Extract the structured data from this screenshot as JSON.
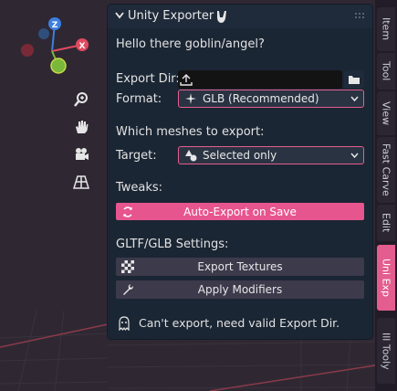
{
  "viewport": {
    "gizmo": {
      "x_label": "X",
      "z_label": "Z"
    },
    "buttons": [
      {
        "icon": "zoom-icon"
      },
      {
        "icon": "hand-pan-icon"
      },
      {
        "icon": "camera-icon"
      },
      {
        "icon": "grid-icon"
      }
    ]
  },
  "panel": {
    "title": "Unity Exporter",
    "title_icon": "sign-of-the-horns-icon",
    "greeting": "Hello there goblin/angel?",
    "export_dir": {
      "label": "Export Dir:",
      "value": ""
    },
    "format": {
      "label": "Format:",
      "selected": "GLB (Recommended)",
      "icon": "sparkle-icon"
    },
    "meshes_heading": "Which meshes to export:",
    "target": {
      "label": "Target:",
      "selected": "Selected only",
      "icon": "objects-icon"
    },
    "tweaks_heading": "Tweaks:",
    "auto_export_label": "Auto-Export on Save",
    "gltf_heading": "GLTF/GLB Settings:",
    "export_textures_label": "Export Textures",
    "apply_modifiers_label": "Apply Modifiers",
    "status_text": "Can't export, need valid Export Dir."
  },
  "tabs": [
    {
      "label": "Item"
    },
    {
      "label": "Tool"
    },
    {
      "label": "View"
    },
    {
      "label": "Fast Carve"
    },
    {
      "label": "Edit"
    },
    {
      "label": "Uni Exp",
      "active": true
    },
    {
      "label": "Ill Tooly"
    }
  ],
  "colors": {
    "accent": "#e7558f",
    "panel_bg": "#1b2634",
    "viewport_bg": "#2f2833",
    "gizmo_x": "#e04a5f",
    "gizmo_z": "#3d7fe0",
    "gizmo_y": "#7ab83a"
  }
}
